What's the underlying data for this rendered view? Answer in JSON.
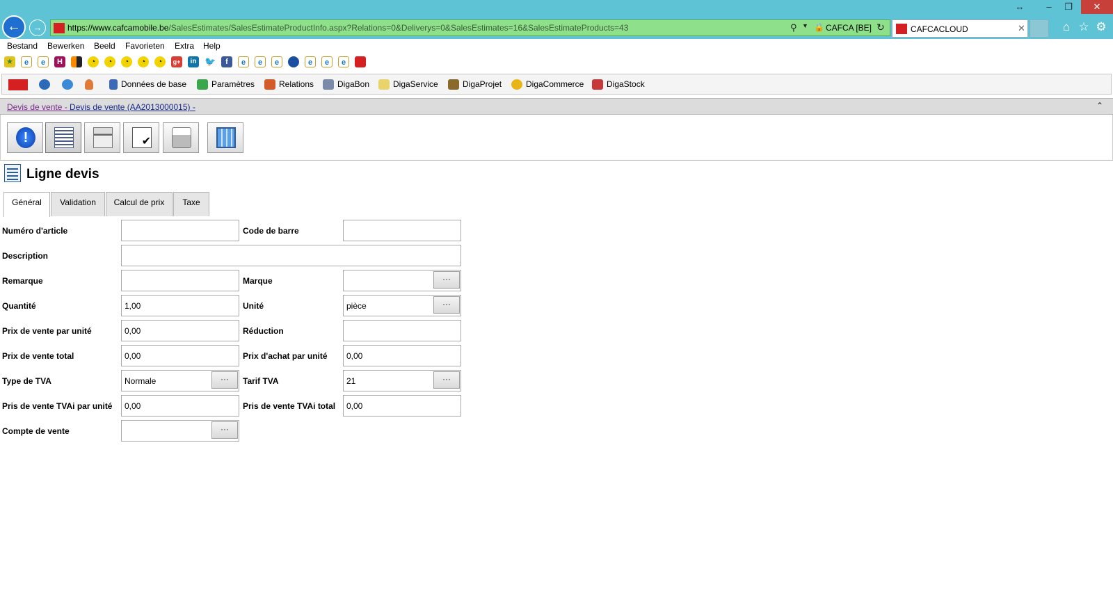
{
  "browser": {
    "url": {
      "scheme": "https://www.",
      "host": "cafcamobile.be",
      "path": "/SalesEstimates/SalesEstimateProductInfo.aspx?Relations=0&Deliverys=0&SalesEstimates=16&SalesEstimateProducts=43"
    },
    "site_identity": "CAFCA [BE]",
    "tab_title": "CAFCACLOUD"
  },
  "menu": [
    "Bestand",
    "Bewerken",
    "Beeld",
    "Favorieten",
    "Extra",
    "Help"
  ],
  "app_toolbar": {
    "items": [
      "Données de base",
      "Paramètres",
      "Relations",
      "DigaBon",
      "DigaService",
      "DigaProjet",
      "DigaCommerce",
      "DigaStock"
    ]
  },
  "breadcrumb": {
    "level1": "Devis de vente - ",
    "level2": "Devis de vente (AA2013000015) -"
  },
  "page_title": "Ligne devis",
  "tabs": [
    "Général",
    "Validation",
    "Calcul de prix",
    "Taxe"
  ],
  "form": {
    "numero_article": {
      "label": "Numéro d'article",
      "value": ""
    },
    "code_barre": {
      "label": "Code de barre",
      "value": ""
    },
    "description": {
      "label": "Description",
      "value": ""
    },
    "remarque": {
      "label": "Remarque",
      "value": ""
    },
    "marque": {
      "label": "Marque",
      "value": ""
    },
    "quantite": {
      "label": "Quantité",
      "value": "1,00"
    },
    "unite": {
      "label": "Unité",
      "value": "pièce"
    },
    "prix_vente_unite": {
      "label": "Prix de vente par unité",
      "value": "0,00"
    },
    "reduction": {
      "label": "Réduction",
      "value": ""
    },
    "prix_vente_total": {
      "label": "Prix de vente total",
      "value": "0,00"
    },
    "prix_achat_unite": {
      "label": "Prix d'achat par unité",
      "value": "0,00"
    },
    "type_tva": {
      "label": "Type de TVA",
      "value": "Normale"
    },
    "tarif_tva": {
      "label": "Tarif TVA",
      "value": "21"
    },
    "prix_tvai_unite": {
      "label": "Pris de vente TVAi par unité",
      "value": "0,00"
    },
    "prix_tvai_total": {
      "label": "Pris de vente TVAi total",
      "value": "0,00"
    },
    "compte_vente": {
      "label": "Compte de vente",
      "value": ""
    },
    "ellipsis": "···"
  },
  "colors": {
    "titlebar": "#5fc3d6",
    "addressbar": "#8fe08a",
    "close_button": "#c7413a",
    "breadcrumb_link1": "#7a2a8a",
    "breadcrumb_link2": "#1a2a8a"
  }
}
